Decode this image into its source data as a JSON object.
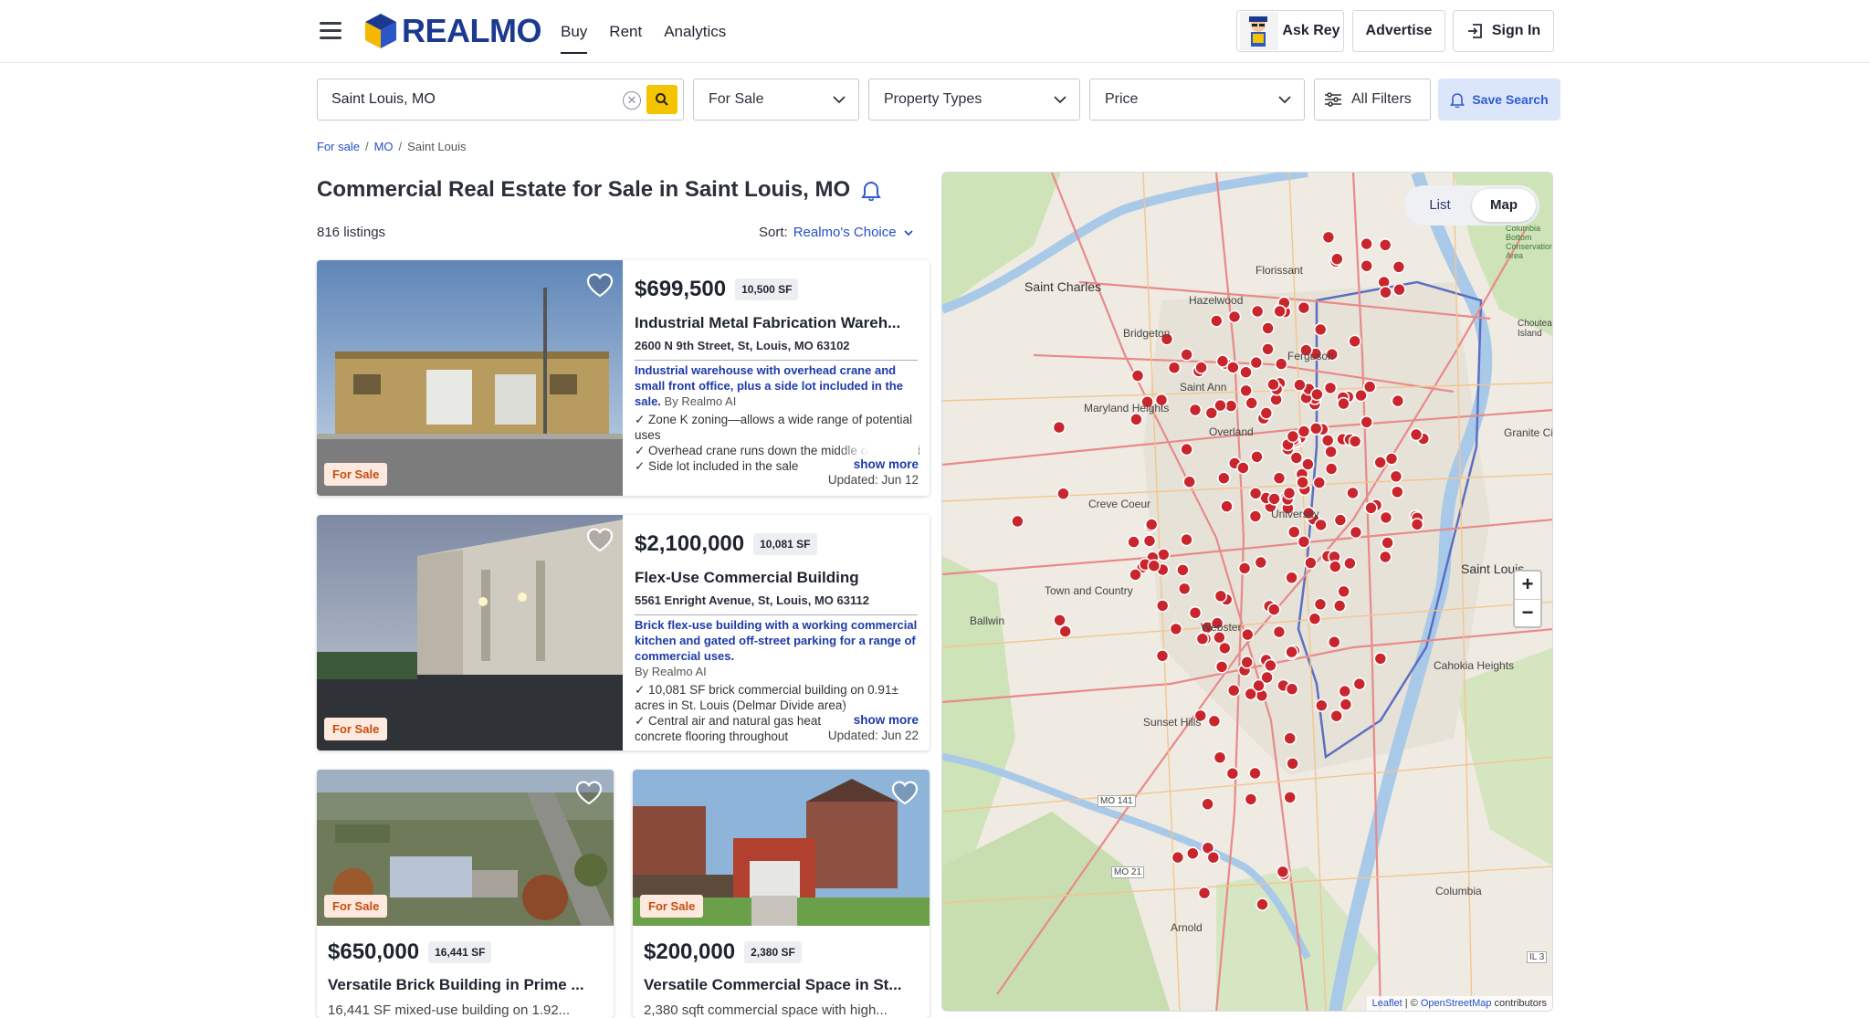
{
  "header": {
    "logo_text": "REALMO",
    "nav": [
      {
        "label": "Buy",
        "active": true
      },
      {
        "label": "Rent",
        "active": false
      },
      {
        "label": "Analytics",
        "active": false
      }
    ],
    "ask_rey": "Ask Rey",
    "advertise": "Advertise",
    "sign_in": "Sign In"
  },
  "search": {
    "location": "Saint Louis, MO",
    "for_sale": "For Sale",
    "property_types": "Property Types",
    "price": "Price",
    "all_filters": "All Filters",
    "save_search": "Save Search"
  },
  "breadcrumb": [
    {
      "label": "For sale",
      "link": true
    },
    {
      "label": "MO",
      "link": true
    },
    {
      "label": "Saint Louis",
      "link": false
    }
  ],
  "page": {
    "title": "Commercial Real Estate for Sale in Saint Louis, MO",
    "count": "816 listings",
    "sort_label": "Sort:",
    "sort_value": "Realmo's Choice"
  },
  "listings": [
    {
      "badge": "For Sale",
      "price": "$699,500",
      "sf": "10,500 SF",
      "title": "Industrial Metal Fabrication Wareh...",
      "address": "2600 N 9th Street, St, Louis, MO 63102",
      "ai_summary": "Industrial warehouse with overhead crane and small front office, plus a side lot included in the sale.",
      "ai_by": "By Realmo AI",
      "bullets": [
        "✓ Zone K zoning—allows a wide range of potential uses",
        "✓ Overhead crane runs down the middle of the building and will remain with",
        "✓ Side lot included in the sale"
      ],
      "show_more": "show more",
      "updated": "Updated: Jun 12"
    },
    {
      "badge": "For Sale",
      "price": "$2,100,000",
      "sf": "10,081 SF",
      "title": "Flex-Use Commercial Building",
      "address": "5561 Enright Avenue, St, Louis, MO 63112",
      "ai_summary": "Brick flex-use building with a working commercial kitchen and gated off-street parking for a range of commercial uses.",
      "ai_by": "By Realmo AI",
      "bullets": [
        "✓ 10,081 SF brick commercial building on 0.91± acres in St. Louis (Delmar Divide area)",
        "✓ Central air and natural gas heat",
        "concrete flooring throughout"
      ],
      "show_more": "show more",
      "updated": "Updated: Jun 22"
    }
  ],
  "small_listings": [
    {
      "badge": "For Sale",
      "price": "$650,000",
      "sf": "16,441 SF",
      "title": "Versatile Brick Building in Prime ...",
      "desc": "16,441 SF mixed-use building on 1.92..."
    },
    {
      "badge": "For Sale",
      "price": "$200,000",
      "sf": "2,380 SF",
      "title": "Versatile Commercial Space in St...",
      "desc": "2,380 sqft commercial space with high..."
    }
  ],
  "map": {
    "toggle": [
      {
        "label": "List",
        "active": false
      },
      {
        "label": "Map",
        "active": true
      }
    ],
    "zoom_in": "+",
    "zoom_out": "−",
    "attribution_leaflet": "Leaflet",
    "attribution_sep": " | © ",
    "attribution_osm": "OpenStreetMap",
    "attribution_rest": " contributors",
    "labels": {
      "saint_charles": "Saint Charles",
      "florissant": "Florissant",
      "hazelwood": "Hazelwood",
      "bridgeton": "Bridgeton",
      "ferguson": "Ferguson",
      "maryland_heights": "Maryland Heights",
      "saint_ann": "Saint Ann",
      "overland": "Overland",
      "creve_coeur": "Creve Coeur",
      "university": "University",
      "town_and_country": "Town and Country",
      "ballwin": "Ballwin",
      "webster": "Webster",
      "sunset_hills": "Sunset Hills",
      "saint_louis": "Saint Louis",
      "cahokia_heights": "Cahokia Heights",
      "granite_city": "Granite City",
      "columbia": "Columbia",
      "arnold": "Arnold",
      "chouteau_island": "Chouteau Island",
      "bottom_area": "Columbia Bottom Conservation Area",
      "mo141": "MO 141",
      "mo21": "MO 21",
      "il3": "IL 3"
    }
  }
}
